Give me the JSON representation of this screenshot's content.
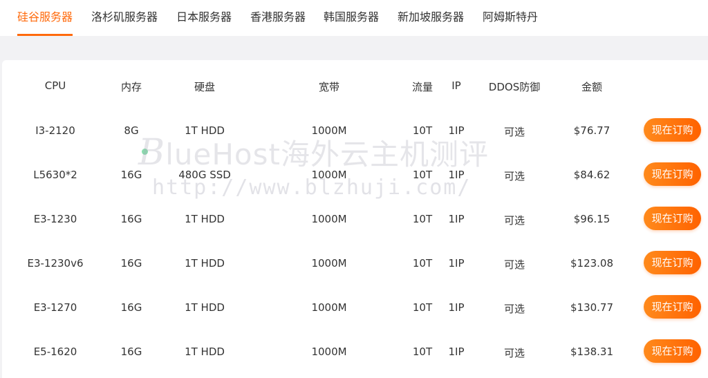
{
  "tabs": [
    "硅谷服务器",
    "洛杉矶服务器",
    "日本服务器",
    "香港服务器",
    "韩国服务器",
    "新加坡服务器",
    "阿姆斯特丹"
  ],
  "active_tab": 0,
  "table": {
    "headers": [
      "CPU",
      "内存",
      "硬盘",
      "宽带",
      "流量",
      "IP",
      "DDOS防御",
      "金额"
    ],
    "rows": [
      [
        "I3-2120",
        "8G",
        "1T HDD",
        "1000M",
        "10T",
        "1IP",
        "可选",
        "$76.77"
      ],
      [
        "L5630*2",
        "16G",
        "480G SSD",
        "1000M",
        "10T",
        "1IP",
        "可选",
        "$84.62"
      ],
      [
        "E3-1230",
        "16G",
        "1T HDD",
        "1000M",
        "10T",
        "1IP",
        "可选",
        "$96.15"
      ],
      [
        "E3-1230v6",
        "16G",
        "1T HDD",
        "1000M",
        "10T",
        "1IP",
        "可选",
        "$123.08"
      ],
      [
        "E3-1270",
        "16G",
        "1T HDD",
        "1000M",
        "10T",
        "1IP",
        "可选",
        "$130.77"
      ],
      [
        "E5-1620",
        "16G",
        "1T HDD",
        "1000M",
        "10T",
        "1IP",
        "可选",
        "$138.31"
      ]
    ],
    "order_label": "现在订购"
  },
  "watermark": {
    "line1_initial": "B",
    "line1_rest": "lueHost海外云主机测评",
    "line2": "http://www.blzhuji.com/"
  },
  "colors": {
    "accent": "#ff6a0c",
    "button_gradient_start": "#ff8a1c",
    "button_gradient_end": "#ff6200"
  }
}
